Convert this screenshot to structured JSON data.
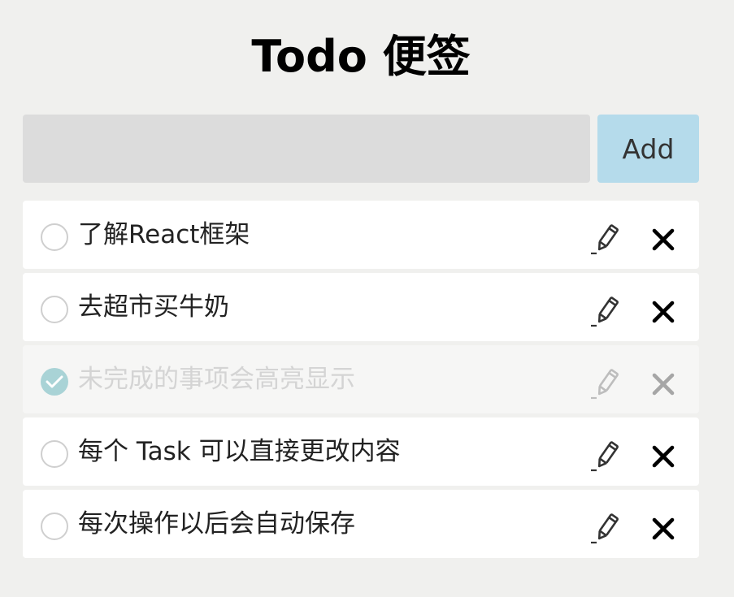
{
  "header": {
    "title": "Todo 便签"
  },
  "new_todo": {
    "input_value": "",
    "input_placeholder": "",
    "add_label": "Add"
  },
  "todos": [
    {
      "text": "了解React框架",
      "completed": false
    },
    {
      "text": "去超市买牛奶",
      "completed": false
    },
    {
      "text": "未完成的事项会高亮显示",
      "completed": true
    },
    {
      "text": "每个 Task 可以直接更改内容",
      "completed": false
    },
    {
      "text": "每次操作以后会自动保存",
      "completed": false
    }
  ],
  "icons": {
    "check": "check-circle-icon",
    "edit": "pencil-icon",
    "delete": "close-icon"
  },
  "colors": {
    "background": "#f0f0ee",
    "item_background": "#ffffff",
    "completed_item_background": "#f6f6f5",
    "input_background": "#dcdcdc",
    "add_button": "#b5dbeb",
    "completed_check": "#a9d3d6",
    "completed_text": "#d4d4d4"
  }
}
